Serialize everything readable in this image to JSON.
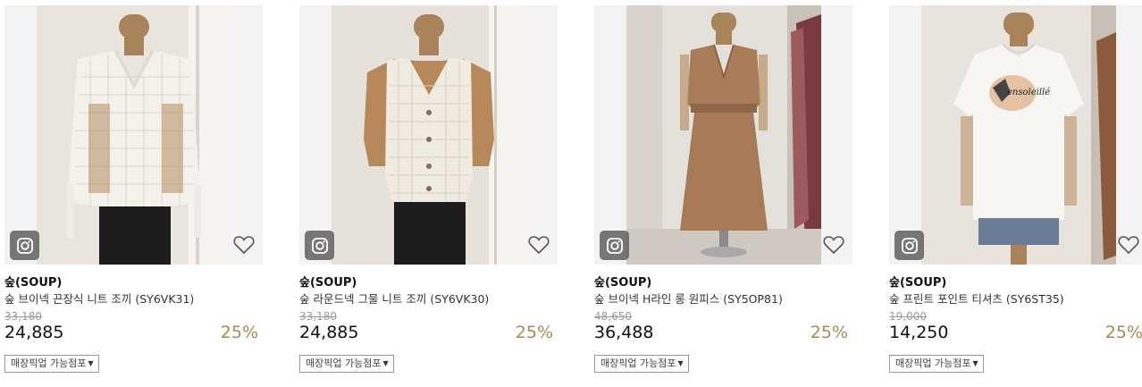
{
  "products": [
    {
      "brand": "숲(SOUP)",
      "name": "숲 브이넥 끈장식 니트 조끼 (SY6VK31)",
      "original_price": "33,180",
      "price": "24,885",
      "discount": "25%",
      "pickup_label": "매장픽업 가능점포"
    },
    {
      "brand": "숲(SOUP)",
      "name": "숲 라운드넥 그물 니트 조끼 (SY6VK30)",
      "original_price": "33,180",
      "price": "24,885",
      "discount": "25%",
      "pickup_label": "매장픽업 가능점포"
    },
    {
      "brand": "숲(SOUP)",
      "name": "숲 브이넥 H라인 롱 원피스 (SY5OP81)",
      "original_price": "48,650",
      "price": "36,488",
      "discount": "25%",
      "pickup_label": "매장픽업 가능점포"
    },
    {
      "brand": "숲(SOUP)",
      "name": "숲 프린트 포인트 티셔츠 (SY6ST35)",
      "original_price": "19,000",
      "price": "14,250",
      "discount": "25%",
      "pickup_label": "매장픽업 가능점포"
    }
  ],
  "product_images": [
    "white mesh knit v-neck vest on mannequin",
    "cream crochet knit button vest on mannequin",
    "brown v-neck long sleeveless dress on mannequin",
    "white printed t-shirt with shorts on mannequin"
  ],
  "print_text": "ensoleillé",
  "icons": {
    "instagram": "instagram-icon",
    "wishlist": "heart-icon",
    "dropdown": "chevron-down-icon"
  },
  "colors": {
    "discount": "#a58a55",
    "strike_price": "#9a9a9a",
    "border": "#999999"
  }
}
